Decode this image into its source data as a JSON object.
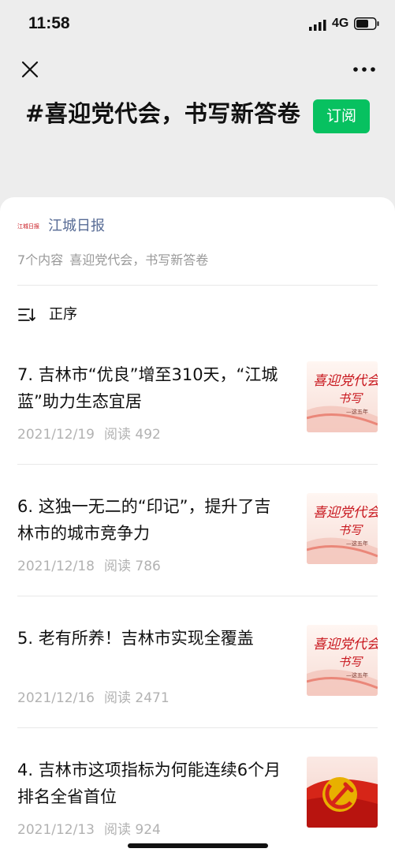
{
  "status_bar": {
    "time": "11:58",
    "network": "4G"
  },
  "topic": {
    "title": "#喜迎党代会，书写新答卷",
    "subscribe_label": "订阅"
  },
  "source": {
    "logo_text": "江城日报",
    "name": "江城日报",
    "count_text": "7个内容",
    "topic_name": "喜迎党代会，书写新答卷"
  },
  "sort": {
    "label": "正序"
  },
  "articles": [
    {
      "title": "7. 吉林市“优良”增至310天，“江城蓝”助力生态宜居",
      "date": "2021/12/19",
      "views": "阅读 492",
      "thumb": "banner"
    },
    {
      "title": "6. 这独一无二的“印记”，提升了吉林市的城市竞争力",
      "date": "2021/12/18",
      "views": "阅读 786",
      "thumb": "banner"
    },
    {
      "title": "5. 老有所养！吉林市实现全覆盖",
      "date": "2021/12/16",
      "views": "阅读 2471",
      "thumb": "banner"
    },
    {
      "title": "4. 吉林市这项指标为何能连续6个月排名全省首位",
      "date": "2021/12/13",
      "views": "阅读 924",
      "thumb": "party-emblem"
    }
  ],
  "thumb_banner": {
    "line1": "喜迎党代会",
    "line2": "书写",
    "line3": "—这五年"
  },
  "colors": {
    "accent_green": "#07c160",
    "link_blue": "#576b95",
    "banner_red": "#c8161d",
    "muted_gray": "#b2b2b2"
  }
}
